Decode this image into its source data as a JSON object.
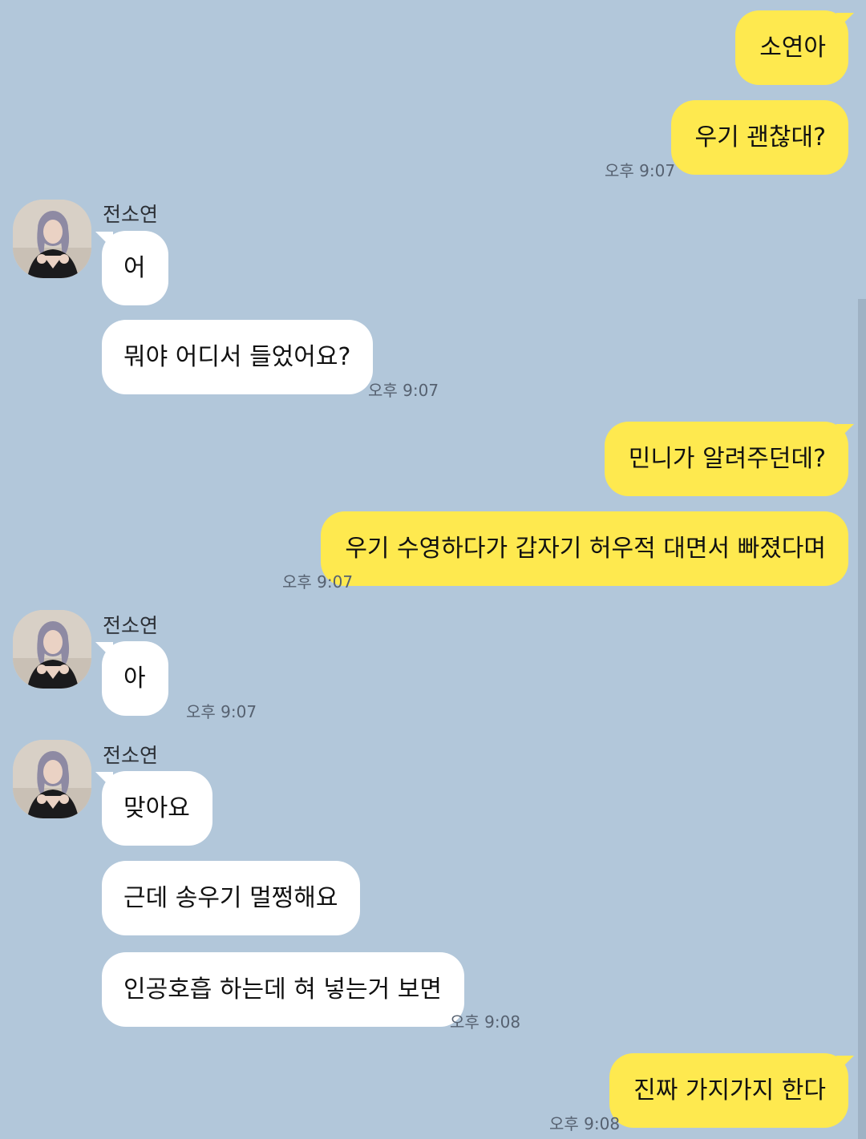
{
  "chat": {
    "sender_name": "전소연",
    "items": [
      {
        "type": "mine",
        "text": "소연아"
      },
      {
        "type": "mine",
        "text": "우기 괜찮대?"
      },
      {
        "type": "time",
        "text": "오후 9:07"
      },
      {
        "type": "sender",
        "text": "전소연"
      },
      {
        "type": "theirs",
        "text": "어"
      },
      {
        "type": "theirs",
        "text": "뭐야 어디서 들었어요?"
      },
      {
        "type": "time",
        "text": "오후 9:07"
      },
      {
        "type": "mine",
        "text": "민니가 알려주던데?"
      },
      {
        "type": "mine",
        "text": "우기 수영하다가 갑자기 허우적 대면서 빠졌다며"
      },
      {
        "type": "time",
        "text": "오후 9:07"
      },
      {
        "type": "sender",
        "text": "전소연"
      },
      {
        "type": "theirs",
        "text": "아"
      },
      {
        "type": "time",
        "text": "오후 9:07"
      },
      {
        "type": "sender",
        "text": "전소연"
      },
      {
        "type": "theirs",
        "text": "맞아요"
      },
      {
        "type": "theirs",
        "text": "근데 송우기 멀쩡해요"
      },
      {
        "type": "theirs",
        "text": "인공호흡 하는데 혀 넣는거 보면"
      },
      {
        "type": "time",
        "text": "오후 9:08"
      },
      {
        "type": "mine",
        "text": "진짜 가지가지 한다"
      },
      {
        "type": "time",
        "text": "오후 9:08"
      }
    ]
  },
  "colors": {
    "background": "#b2c7da",
    "mine_bubble": "#fee94f",
    "theirs_bubble": "#ffffff",
    "timestamp": "#566170"
  },
  "icons": {
    "avatar": "profile-photo-avatar"
  }
}
